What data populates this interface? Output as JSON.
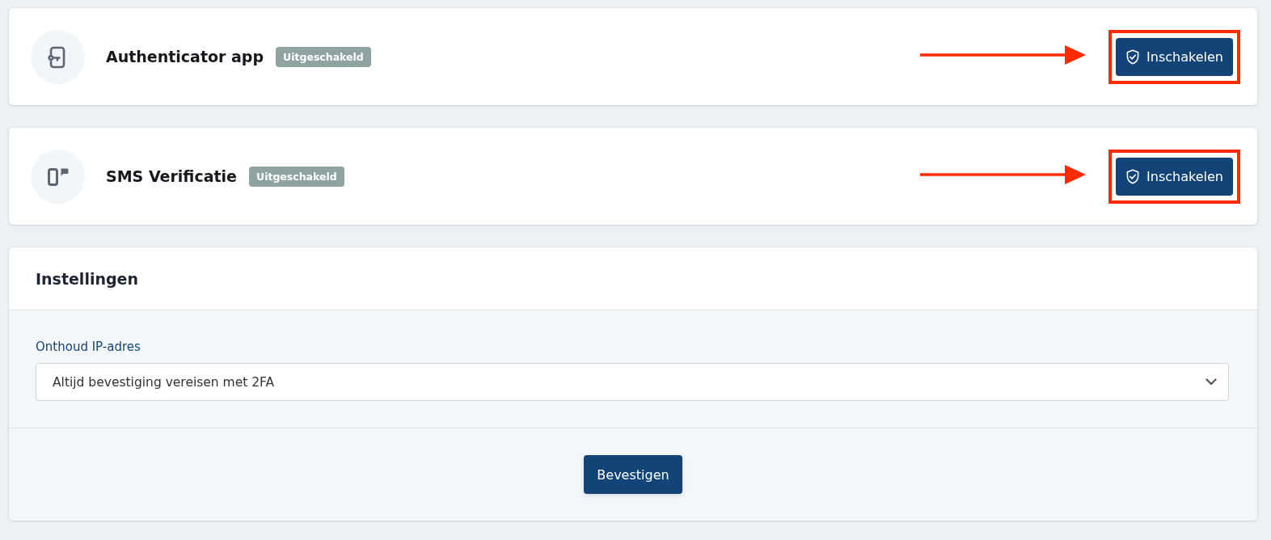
{
  "methods": [
    {
      "kind": "authenticator",
      "title": "Authenticator app",
      "status": "Uitgeschakeld",
      "action": "Inschakelen",
      "annotated": true
    },
    {
      "kind": "sms",
      "title": "SMS Verificatie",
      "status": "Uitgeschakeld",
      "action": "Inschakelen",
      "annotated": true
    }
  ],
  "settings": {
    "title": "Instellingen",
    "field": {
      "label": "Onthoud IP-adres",
      "value": "Altijd bevestiging vereisen met 2FA"
    },
    "submit": "Bevestigen"
  }
}
